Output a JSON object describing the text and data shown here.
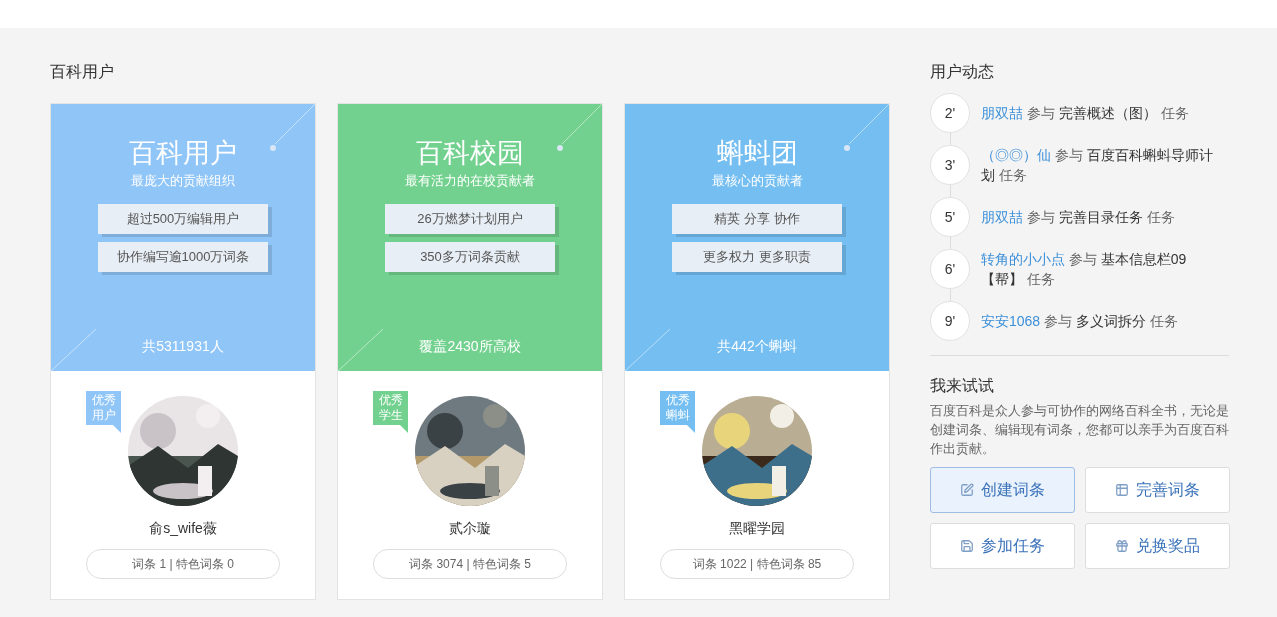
{
  "section_title": "百科用户",
  "cards": [
    {
      "title": "百科用户",
      "subtitle": "最庞大的贡献组织",
      "features": [
        "超过500万编辑用户",
        "协作编写逾1000万词条"
      ],
      "total": "共5311931人",
      "color": "#90c5f7",
      "tag": [
        "优秀",
        "用户"
      ],
      "avatar": {
        "kind": "picture"
      },
      "name": "俞s_wife薇",
      "stats": "词条 1 | 特色词条 0"
    },
    {
      "title": "百科校园",
      "subtitle": "最有活力的在校贡献者",
      "features": [
        "26万燃梦计划用户",
        "350多万词条贡献"
      ],
      "total": "覆盖2430所高校",
      "color": "#73d18f",
      "tag": [
        "优秀",
        "学生"
      ],
      "avatar": {
        "kind": "picture"
      },
      "name": "贰尒璇",
      "stats": "词条 3074 | 特色词条 5"
    },
    {
      "title": "蝌蚪团",
      "subtitle": "最核心的贡献者",
      "features": [
        "精英 分享 协作",
        "更多权力 更多职责"
      ],
      "total": "共442个蝌蚪",
      "color": "#74bef2",
      "tag": [
        "优秀",
        "蝌蚪"
      ],
      "avatar": {
        "kind": "picture"
      },
      "name": "黑曜学园",
      "stats": "词条 1022 | 特色词条 85"
    }
  ],
  "activity": {
    "title": "用户动态",
    "items": [
      {
        "time": "2'",
        "user": "朋双喆",
        "action": "参与",
        "task": "完善概述（图）",
        "suffix": "任务"
      },
      {
        "time": "3'",
        "user": "（◎◎）仙",
        "action": "参与",
        "task": "百度百科蝌蚪导师计划",
        "suffix": "任务"
      },
      {
        "time": "5'",
        "user": "朋双喆",
        "action": "参与",
        "task": "完善目录任务",
        "suffix": "任务"
      },
      {
        "time": "6'",
        "user": "转角的小小点",
        "action": "参与",
        "task": "基本信息栏09【帮】",
        "suffix": "任务"
      },
      {
        "time": "9'",
        "user": "安安1068",
        "action": "参与",
        "task": "多义词拆分",
        "suffix": "任务"
      }
    ]
  },
  "try": {
    "title": "我来试试",
    "description": "百度百科是众人参与可协作的网络百科全书，无论是创建词条、编辑现有词条，您都可以亲手为百度百科作出贡献。",
    "buttons": [
      {
        "label": "创建词条",
        "selected": true
      },
      {
        "label": "完善词条",
        "selected": false
      },
      {
        "label": "参加任务",
        "selected": false
      },
      {
        "label": "兑换奖品",
        "selected": false
      }
    ]
  }
}
